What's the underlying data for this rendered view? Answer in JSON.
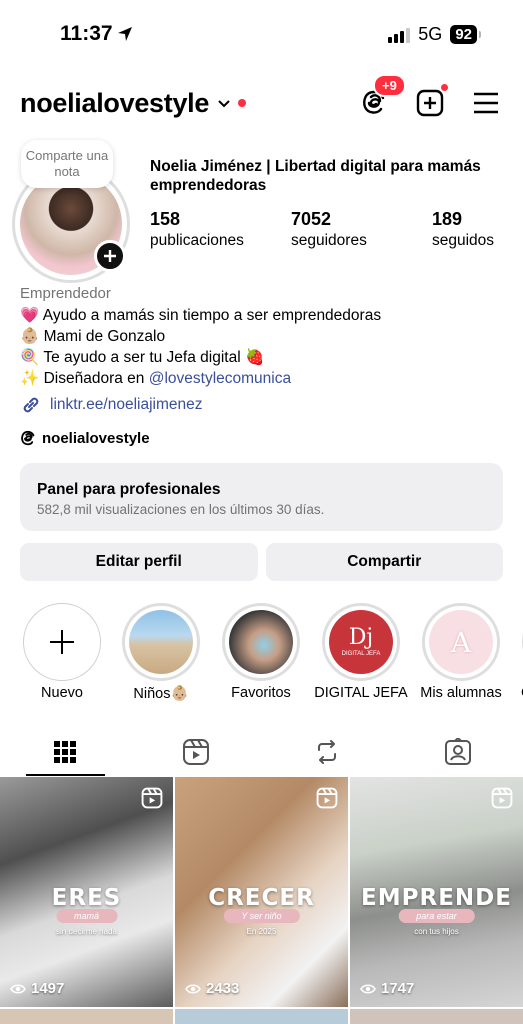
{
  "status_bar": {
    "time": "11:37",
    "network": "5G",
    "battery": "92"
  },
  "header": {
    "username": "noelialovestyle",
    "threads_badge": "+9"
  },
  "profile": {
    "note_bubble": "Comparte una nota",
    "full_name": "Noelia Jiménez | Libertad digital para mamás emprendedoras",
    "stats": [
      {
        "value": "158",
        "label": "publicaciones"
      },
      {
        "value": "7052",
        "label": "seguidores"
      },
      {
        "value": "189",
        "label": "seguidos"
      }
    ],
    "category": "Emprendedor",
    "bio_lines": [
      {
        "emoji": "💗",
        "text": "Ayudo a mamás sin tiempo a ser emprendedoras"
      },
      {
        "emoji": "👶🏼",
        "text": "Mami de Gonzalo"
      },
      {
        "emoji": "🍭",
        "text": "Te ayudo a ser tu Jefa digital 🍓"
      }
    ],
    "bio_mention_prefix": "✨ Diseñadora en ",
    "bio_mention": "@lovestylecomunica",
    "link": "linktr.ee/noeliajimenez",
    "threads_handle": "noelialovestyle"
  },
  "panel": {
    "title": "Panel para profesionales",
    "subtitle": "582,8 mil visualizaciones en los últimos 30 días."
  },
  "actions": {
    "edit": "Editar perfil",
    "share": "Compartir"
  },
  "highlights": [
    {
      "label": "Nuevo"
    },
    {
      "label": "Niños👶🏼"
    },
    {
      "label": "Favoritos"
    },
    {
      "label": "DIGITAL JEFA",
      "mark": "Dj",
      "mark_sub": "DIGITAL JEFA"
    },
    {
      "label": "Mis alumnas",
      "mark": "A"
    },
    {
      "label": "C"
    }
  ],
  "tabs": [
    "grid-icon",
    "reels-icon",
    "reposts-icon",
    "tagged-icon"
  ],
  "posts": [
    {
      "title": "ERES",
      "pill": "mamá",
      "small": "sin decirme nada",
      "views": "1497"
    },
    {
      "title": "CRECER",
      "pill": "Y ser niño",
      "small": "En 2025",
      "views": "2433"
    },
    {
      "title": "EMPRENDE",
      "pill": "para estar",
      "small": "con tus hijos",
      "views": "1747"
    }
  ]
}
